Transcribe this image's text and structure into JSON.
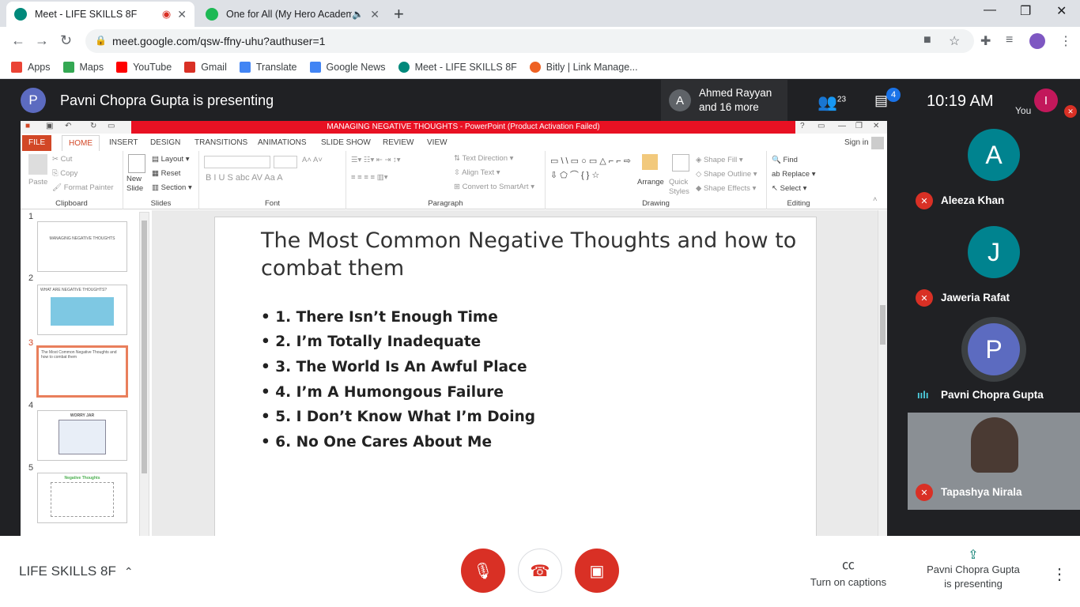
{
  "browser": {
    "tabs": [
      {
        "title": "Meet - LIFE SKILLS 8F",
        "color": "#00897b"
      },
      {
        "title": "One for All (My Hero Academ",
        "color": "#1db954"
      }
    ],
    "url": "meet.google.com/qsw-ffny-uhu?authuser=1",
    "bookmarks": [
      {
        "label": "Apps",
        "color": "#ea4335"
      },
      {
        "label": "Maps",
        "color": "#34a853"
      },
      {
        "label": "YouTube",
        "color": "#ff0000"
      },
      {
        "label": "Gmail",
        "color": "#d93025"
      },
      {
        "label": "Translate",
        "color": "#4285f4"
      },
      {
        "label": "Google News",
        "color": "#4285f4"
      },
      {
        "label": "Meet - LIFE SKILLS 8F",
        "color": "#00897b"
      },
      {
        "label": "Bitly | Link Manage...",
        "color": "#ee6123"
      }
    ]
  },
  "meet": {
    "presenter_initial": "P",
    "presenting_title": "Pavni Chopra Gupta is presenting",
    "participant_box": {
      "initial": "A",
      "line1": "Ahmed Rayyan",
      "line2": "and 16 more"
    },
    "people_count": "23",
    "chat_badge": "4",
    "time": "10:19 AM",
    "you_label": "You",
    "you_initial": "I",
    "tiles": [
      {
        "initial": "A",
        "name": "Aleeza Khan",
        "color": "#00838f"
      },
      {
        "initial": "J",
        "name": "Jaweria Rafat",
        "color": "#00838f"
      },
      {
        "initial": "P",
        "name": "Pavni Chopra Gupta",
        "color": "#5c6bc0"
      },
      {
        "name": "Tapashya Nirala"
      }
    ],
    "meeting_name": "LIFE SKILLS 8F",
    "captions_label": "Turn on captions",
    "present_line1": "Pavni Chopra Gupta",
    "present_line2": "is presenting"
  },
  "ppt": {
    "title_bar": "MANAGING NEGATIVE THOUGHTS -  PowerPoint (Product Activation Failed)",
    "tabs": [
      "FILE",
      "HOME",
      "INSERT",
      "DESIGN",
      "TRANSITIONS",
      "ANIMATIONS",
      "SLIDE SHOW",
      "REVIEW",
      "VIEW"
    ],
    "sign_in": "Sign in",
    "groups": {
      "clipboard": "Clipboard",
      "slides": "Slides",
      "font": "Font",
      "paragraph": "Paragraph",
      "drawing": "Drawing",
      "editing": "Editing"
    },
    "ribbon": {
      "paste": "Paste",
      "cut": "Cut",
      "copy": "Copy",
      "format_painter": "Format Painter",
      "new_slide": "New Slide",
      "layout": "Layout",
      "reset": "Reset",
      "section": "Section",
      "text_direction": "Text Direction",
      "align_text": "Align Text",
      "smartart": "Convert to SmartArt",
      "arrange": "Arrange",
      "quick_styles": "Quick Styles",
      "shape_fill": "Shape Fill",
      "shape_outline": "Shape Outline",
      "shape_effects": "Shape Effects",
      "find": "Find",
      "replace": "Replace",
      "select": "Select"
    },
    "thumbnails": [
      {
        "num": "1",
        "text": "MANAGING NEGATIVE THOUGHTS"
      },
      {
        "num": "2",
        "text": "WHAT ARE NEGATIVE THOUGHTS?"
      },
      {
        "num": "3",
        "text": "The Most Common Negative Thoughts and how to combat them"
      },
      {
        "num": "4",
        "text": "WORRY JAR"
      },
      {
        "num": "5",
        "text": "Negative Thoughts"
      }
    ],
    "slide": {
      "title": "The Most Common Negative Thoughts and how to combat them",
      "bullets": [
        "• 1. There Isn’t Enough Time",
        "• 2. I’m Totally Inadequate",
        "• 3. The World Is An Awful Place",
        "• 4. I’m A Humongous Failure",
        "• 5. I Don’t Know What I’m Doing",
        "• 6. No One Cares About Me"
      ]
    }
  }
}
